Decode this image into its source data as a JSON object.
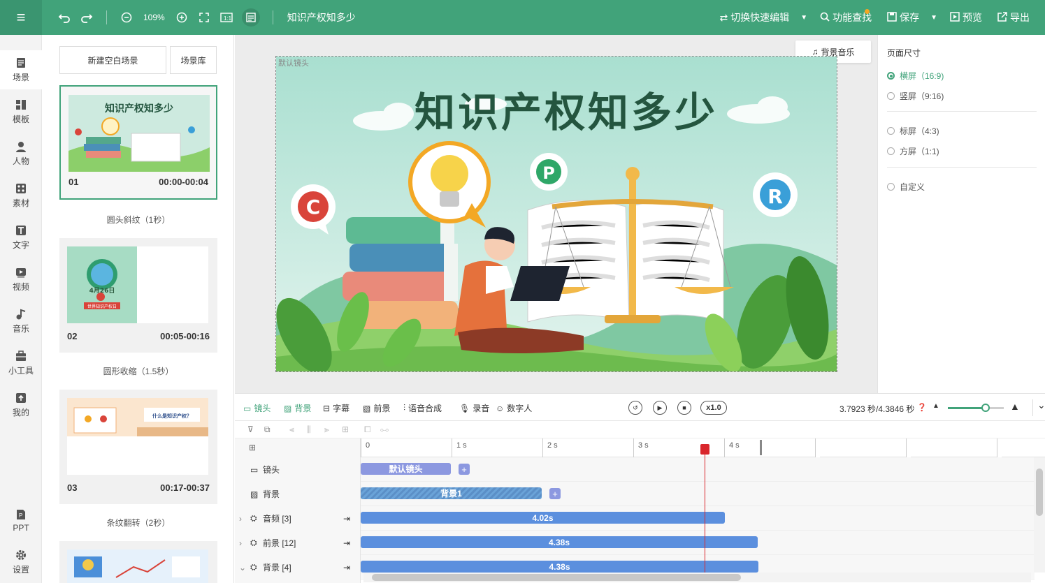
{
  "app": {
    "doc_title": "知识产权知多少",
    "zoom": "109%",
    "toolbar": {
      "switch_edit": "切换快速编辑",
      "find": "功能查找",
      "save": "保存",
      "preview": "预览",
      "export": "导出"
    }
  },
  "nav": [
    {
      "label": "场景",
      "icon": "scene-icon"
    },
    {
      "label": "模板",
      "icon": "template-icon"
    },
    {
      "label": "人物",
      "icon": "person-icon"
    },
    {
      "label": "素材",
      "icon": "material-icon"
    },
    {
      "label": "文字",
      "icon": "text-icon"
    },
    {
      "label": "视频",
      "icon": "video-icon"
    },
    {
      "label": "音乐",
      "icon": "music-icon"
    },
    {
      "label": "小工具",
      "icon": "toolbox-icon"
    },
    {
      "label": "我的",
      "icon": "upload-icon"
    },
    {
      "label": "PPT",
      "icon": "ppt-icon"
    },
    {
      "label": "设置",
      "icon": "gear-icon"
    }
  ],
  "scenes_panel": {
    "new_blank": "新建空白场景",
    "library": "场景库",
    "cards": [
      {
        "index": "01",
        "time": "00:00-00:04",
        "transition": "圆头斜纹（1秒）"
      },
      {
        "index": "02",
        "time": "00:05-00:16",
        "transition": "圆形收缩（1.5秒）"
      },
      {
        "index": "03",
        "time": "00:17-00:37",
        "transition": "条纹翻转（2秒）"
      }
    ],
    "thumb_texts": {
      "t1_title": "知识产权知多少",
      "t2_date": "4月26日",
      "t2_sub": "世界知识产权日",
      "t3_title": "什么是知识产权？"
    }
  },
  "canvas": {
    "bgm_button": "背景音乐",
    "lens_label": "默认镜头",
    "title": "知识产权知多少",
    "badge_c": "C",
    "badge_p": "P",
    "badge_r": "R"
  },
  "page_size": {
    "title": "页面尺寸",
    "options": [
      "横屏（16:9)",
      "竖屏（9:16)",
      "标屏（4:3)",
      "方屏（1:1)",
      "自定义"
    ],
    "selected": 0
  },
  "tools": {
    "lens": "镜头",
    "background": "背景",
    "subtitle": "字幕",
    "foreground": "前景",
    "tts": "语音合成",
    "record": "录音",
    "digital_human": "数字人",
    "speed": "x1.0",
    "time": "3.7923 秒/4.3846 秒",
    "slider_fraction": 0.67
  },
  "timeline": {
    "ruler": [
      "0",
      "1 s",
      "2 s",
      "3 s",
      "4 s"
    ],
    "tracks": [
      {
        "label": "镜头",
        "clip": "默认镜头"
      },
      {
        "label": "背景",
        "clip": "背景1"
      },
      {
        "label": "音频 [3]",
        "clip": "4.02s"
      },
      {
        "label": "前景 [12]",
        "clip": "4.38s"
      },
      {
        "label": "背景 [4]",
        "clip": "4.38s"
      }
    ]
  },
  "colors": {
    "accent": "#41a37a",
    "clip_blue": "#5b8fde",
    "clip_lens": "#8c98e0",
    "playhead": "#d9262c"
  }
}
